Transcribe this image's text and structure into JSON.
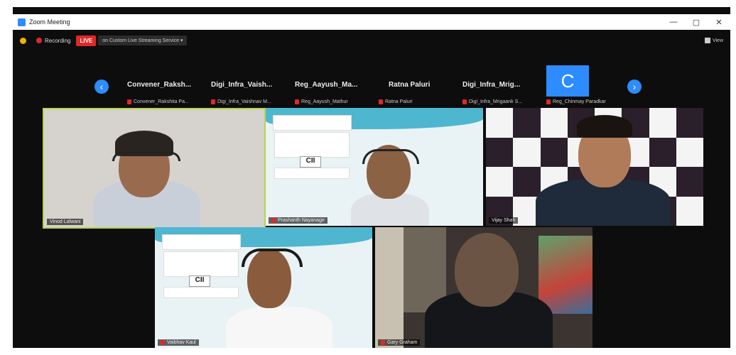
{
  "window": {
    "title": "Zoom Meeting",
    "controls": [
      "—",
      "▢",
      "✕"
    ]
  },
  "topbar": {
    "recording": "Recording",
    "live": "LIVE",
    "stream": "on Custom Live Streaming Service ▾",
    "view": "View"
  },
  "strip": {
    "prev": "‹",
    "next": "›",
    "items": [
      {
        "name": "Convener_Raksh...",
        "label": "Convener_Rakshita Pa..."
      },
      {
        "name": "Digi_Infra_Vaish...",
        "label": "Digi_Infra_Vaishnav M..."
      },
      {
        "name": "Reg_Aayush_Ma...",
        "label": "Reg_Aayush_Mathur"
      },
      {
        "name": "Ratna Paluri",
        "label": "Ratna Paluri"
      },
      {
        "name": "Digi_Infra_Mrig...",
        "label": "Digi_Infra_Mrigaank S..."
      },
      {
        "avatar": "C",
        "label": "Reg_Chinmay Paradkar"
      }
    ]
  },
  "tiles": [
    {
      "name": "Vinod Lalwani"
    },
    {
      "name": "Prashanth Nayanage"
    },
    {
      "name": "Vijay Shah"
    },
    {
      "name": "Vaibhav Kaul"
    },
    {
      "name": "Gary Graham"
    }
  ],
  "slides": {
    "cii": "CII"
  },
  "colors": {
    "accent": "#2d8cff",
    "live": "#e02828",
    "active_speaker": "#b8d44a"
  }
}
